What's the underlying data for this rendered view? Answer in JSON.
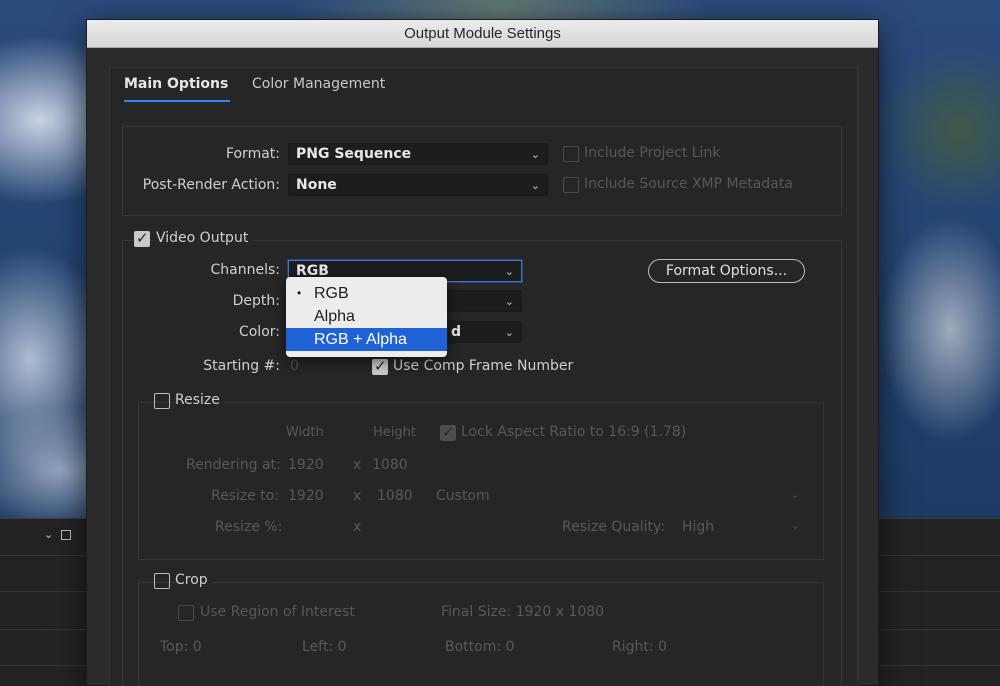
{
  "dialog": {
    "title": "Output Module Settings"
  },
  "tabs": [
    {
      "label": "Main Options",
      "active": true
    },
    {
      "label": "Color Management",
      "active": false
    }
  ],
  "format_section": {
    "format_label": "Format:",
    "format_value": "PNG Sequence",
    "post_render_label": "Post-Render Action:",
    "post_render_value": "None",
    "include_project_link_label": "Include Project Link",
    "include_source_xmp_label": "Include Source XMP Metadata"
  },
  "video_output": {
    "label": "Video Output",
    "checked": true,
    "channels_label": "Channels:",
    "channels_value": "RGB",
    "depth_label": "Depth:",
    "color_label": "Color:",
    "color_value_partial": "d",
    "starting_label": "Starting #:",
    "starting_value": "0",
    "use_comp_frame_label": "Use Comp Frame Number",
    "format_options_button": "Format Options..."
  },
  "channels_menu": {
    "items": [
      {
        "label": "RGB",
        "selected": true,
        "highlighted": false
      },
      {
        "label": "Alpha",
        "selected": false,
        "highlighted": false
      },
      {
        "label": "RGB + Alpha",
        "selected": false,
        "highlighted": true
      }
    ]
  },
  "resize": {
    "label": "Resize",
    "width_header": "Width",
    "height_header": "Height",
    "lock_aspect_label": "Lock Aspect Ratio to 16:9 (1.78)",
    "rendering_at_label": "Rendering at:",
    "rendering_width": "1920",
    "rendering_height": "1080",
    "resize_to_label": "Resize to:",
    "resize_to_width": "1920",
    "resize_to_height": "1080",
    "resize_preset": "Custom",
    "resize_pct_label": "Resize %:",
    "times": "x",
    "resize_quality_label": "Resize Quality:",
    "resize_quality_value": "High"
  },
  "crop": {
    "label": "Crop",
    "use_roi_label": "Use Region of Interest",
    "final_size": "Final Size: 1920 x 1080",
    "top": "Top:  0",
    "left": "Left:  0",
    "bottom": "Bottom:  0",
    "right": "Right:  0"
  },
  "icons": {
    "chevron": "⌄",
    "bullet": "•"
  }
}
